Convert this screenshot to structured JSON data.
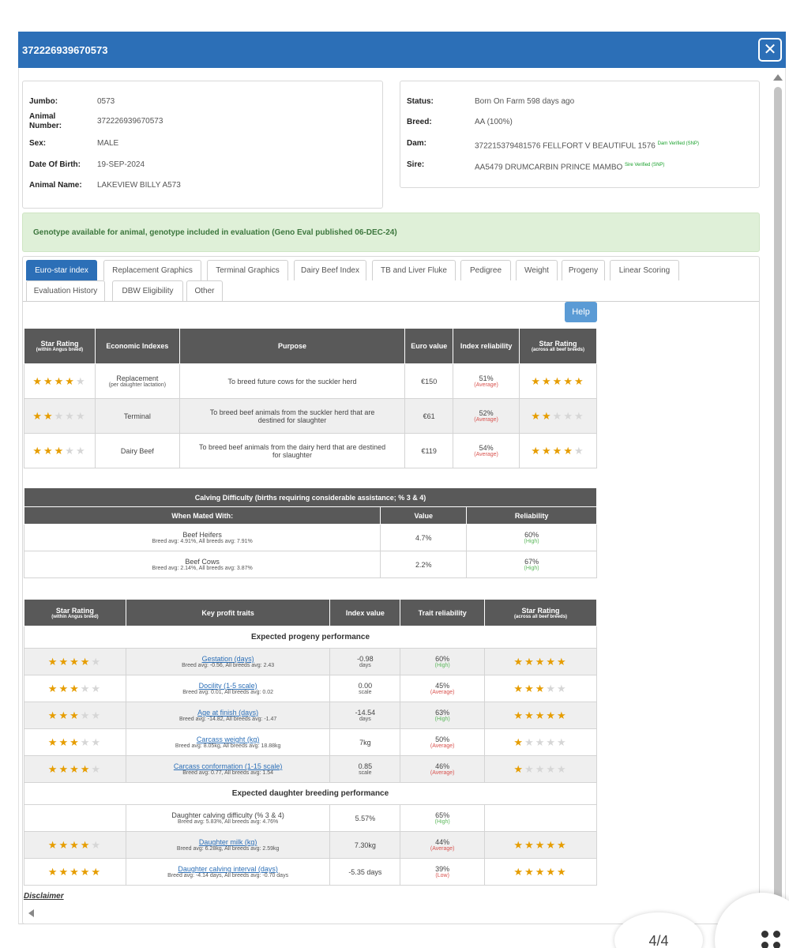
{
  "window": {
    "title": "372226939670573"
  },
  "animal": {
    "left": [
      {
        "label": "Jumbo:",
        "value": "0573"
      },
      {
        "label": "Animal Number:",
        "value": "372226939670573"
      },
      {
        "label": "Sex:",
        "value": "MALE"
      },
      {
        "label": "Date Of Birth:",
        "value": "19-SEP-2024"
      },
      {
        "label": "Animal Name:",
        "value": "LAKEVIEW BILLY A573"
      }
    ],
    "right": [
      {
        "label": "Status:",
        "value": "Born On Farm 598 days ago",
        "badge": ""
      },
      {
        "label": "Breed:",
        "value": "AA (100%)",
        "badge": ""
      },
      {
        "label": "Dam:",
        "value": "372215379481576 FELLFORT V BEAUTIFUL 1576",
        "badge": "Dam Verified (SNP)"
      },
      {
        "label": "Sire:",
        "value": "AA5479 DRUMCARBIN PRINCE MAMBO",
        "badge": "Sire Verified (SNP)"
      }
    ]
  },
  "alert": {
    "text": "Genotype available for animal, genotype included in evaluation (Geno Eval published 06-DEC-24)"
  },
  "tabs": [
    "Euro-star index",
    "Replacement Graphics",
    "Terminal Graphics",
    "Dairy Beef Index",
    "TB and Liver Fluke",
    "Pedigree",
    "Weight",
    "Progeny",
    "Linear Scoring",
    "Evaluation History",
    "DBW Eligibility",
    "Other"
  ],
  "help_label": "Help",
  "index_table": {
    "headers": {
      "star_within": "Star Rating",
      "star_within_sub": "(within Angus breed)",
      "economic": "Economic Indexes",
      "purpose": "Purpose",
      "euro": "Euro value",
      "reliability": "Index reliability",
      "star_across": "Star Rating",
      "star_across_sub": "(across all beef breeds)"
    },
    "rows": [
      {
        "stars_within": 4,
        "index": "Replacement",
        "index_sub": "(per daughter lactation)",
        "purpose": "To breed future cows for the suckler herd",
        "euro": "€150",
        "reliability": "51%",
        "rel_label": "(Average)",
        "stars_across": 5
      },
      {
        "stars_within": 2,
        "index": "Terminal",
        "index_sub": "",
        "purpose": "To breed beef animals from the suckler herd that are destined for slaughter",
        "euro": "€61",
        "reliability": "52%",
        "rel_label": "(Average)",
        "stars_across": 2
      },
      {
        "stars_within": 3,
        "index": "Dairy Beef",
        "index_sub": "",
        "purpose": "To breed beef animals from the dairy herd that are destined for slaughter",
        "euro": "€119",
        "reliability": "54%",
        "rel_label": "(Average)",
        "stars_across": 4
      }
    ]
  },
  "calving_table": {
    "title": "Calving Difficulty (births requiring considerable assistance; % 3 & 4)",
    "headers": {
      "mated": "When Mated With:",
      "value": "Value",
      "reliability": "Reliability"
    },
    "rows": [
      {
        "name": "Beef Heifers",
        "avg": "Breed avg: 4.91%, All breeds avg: 7.91%",
        "value": "4.7%",
        "reliability": "60%",
        "rel_label": "(High)"
      },
      {
        "name": "Beef Cows",
        "avg": "Breed avg: 2.14%, All breeds avg: 3.87%",
        "value": "2.2%",
        "reliability": "67%",
        "rel_label": "(High)"
      }
    ]
  },
  "traits_table": {
    "headers": {
      "star_within": "Star Rating",
      "star_within_sub": "(within Angus breed)",
      "trait": "Key profit traits",
      "index_value": "Index value",
      "reliability": "Trait reliability",
      "star_across": "Star Rating",
      "star_across_sub": "(across all beef breeds)"
    },
    "section1": "Expected progeny performance",
    "section2": "Expected daughter breeding performance",
    "progeny": [
      {
        "stars_within": 4,
        "trait": "Gestation (days)",
        "avg": "Breed avg: -0.56, All breeds avg: 2.43",
        "value": "-0.98",
        "unit": "days",
        "reliability": "60%",
        "rel_label": "(High)",
        "stars_across": 5
      },
      {
        "stars_within": 3,
        "trait": "Docility (1-5 scale)",
        "avg": "Breed avg: 0.01, All breeds avg: 0.02",
        "value": "0.00",
        "unit": "scale",
        "reliability": "45%",
        "rel_label": "(Average)",
        "stars_across": 3
      },
      {
        "stars_within": 3,
        "trait": "Age at finish (days)",
        "avg": "Breed avg: -14.82, All breeds avg: -1.47",
        "value": "-14.54",
        "unit": "days",
        "reliability": "63%",
        "rel_label": "(High)",
        "stars_across": 5
      },
      {
        "stars_within": 3,
        "trait": "Carcass weight (kg)",
        "avg": "Breed avg: 8.05kg, All breeds avg: 18.88kg",
        "value": "7kg",
        "unit": "",
        "reliability": "50%",
        "rel_label": "(Average)",
        "stars_across": 1
      },
      {
        "stars_within": 4,
        "trait": "Carcass conformation (1-15 scale)",
        "avg": "Breed avg: 0.77, All breeds avg: 1.54",
        "value": "0.85",
        "unit": "scale",
        "reliability": "46%",
        "rel_label": "(Average)",
        "stars_across": 1
      }
    ],
    "daughter": [
      {
        "stars_within": 0,
        "trait": "Daughter calving difficulty (% 3 & 4)",
        "link": false,
        "avg": "Breed avg: 5.83%, All breeds avg: 4.76%",
        "value": "5.57%",
        "unit": "",
        "reliability": "65%",
        "rel_label": "(High)",
        "stars_across": 0
      },
      {
        "stars_within": 4,
        "trait": "Daughter milk (kg)",
        "link": true,
        "avg": "Breed avg: 6.28kg, All breeds avg: 2.59kg",
        "value": "7.30kg",
        "unit": "",
        "reliability": "44%",
        "rel_label": "(Average)",
        "stars_across": 5
      },
      {
        "stars_within": 5,
        "trait": "Daughter calving interval (days)",
        "link": true,
        "avg": "Breed avg: -4.14 days, All breeds avg: -0.70 days",
        "value": "-5.35 days",
        "unit": "",
        "reliability": "39%",
        "rel_label": "(Low)",
        "stars_across": 5
      }
    ]
  },
  "disclaimer": "Disclaimer",
  "page_indicator": "4/4",
  "colors": {
    "header_blue": "#2c6fb7",
    "star_gold": "#e69d00",
    "alert_green": "#dff0d8",
    "table_header": "#595959"
  }
}
